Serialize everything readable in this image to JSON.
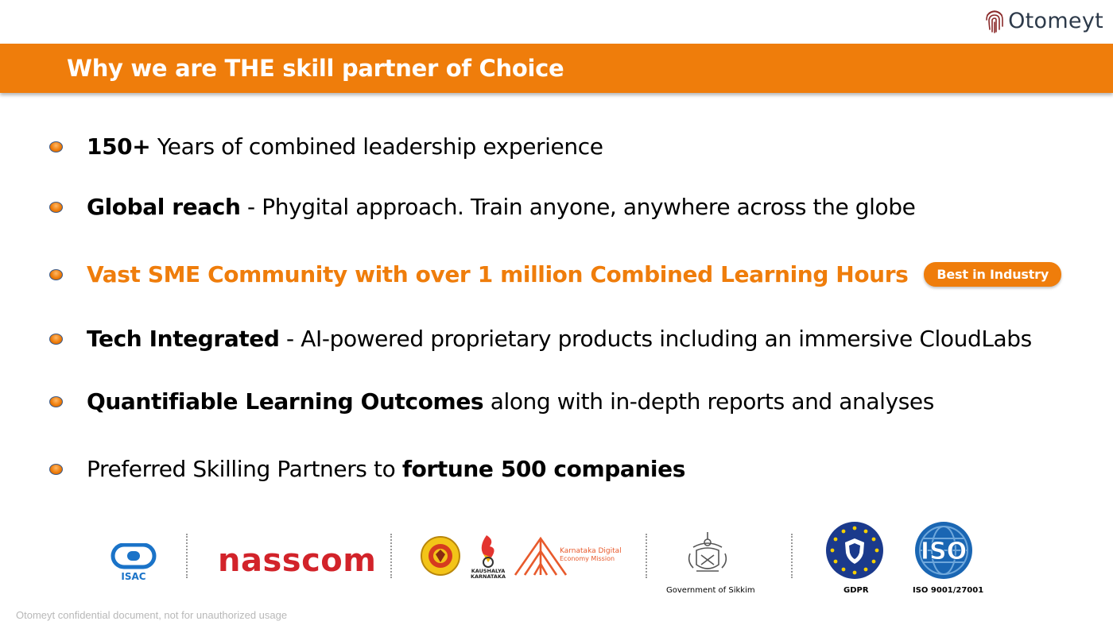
{
  "brand": {
    "name": "Otomeyt",
    "icon": "fingerprint-icon"
  },
  "header": {
    "title": "Why we are THE skill partner of Choice"
  },
  "bullets": [
    {
      "bold": "150+",
      "text": " Years of combined leadership experience"
    },
    {
      "bold": "Global reach",
      "text": " -  Phygital approach. Train anyone, anywhere across the globe"
    },
    {
      "highlight": "Vast SME Community with over 1 million Combined Learning Hours",
      "badge": "Best in Industry"
    },
    {
      "bold": "Tech Integrated",
      "text": " - AI-powered proprietary products including an immersive CloudLabs"
    },
    {
      "bold": "Quantifiable Learning Outcomes",
      "text": " along with in-depth reports and analyses"
    },
    {
      "text": "Preferred Skilling Partners to ",
      "bold": "fortune 500 companies"
    }
  ],
  "logos": {
    "isac": {
      "label": "ISAC",
      "icon": "isac-logo"
    },
    "nasscom": {
      "label": "nasscom"
    },
    "karnataka_gov": {
      "label": "GOVERNMENT OF KARNATAKA",
      "icon": "karnataka-emblem"
    },
    "kaushalya": {
      "label": "KAUSHALYA KARNATAKA",
      "icon": "kaushalya-logo"
    },
    "kdem": {
      "label": "Karnataka Digital Economy Mission",
      "icon": "kdem-logo"
    },
    "sikkim": {
      "caption": "Government of Sikkim",
      "icon": "sikkim-emblem"
    },
    "gdpr": {
      "caption": "GDPR",
      "icon": "gdpr-shield-icon"
    },
    "iso": {
      "label": "ISO",
      "caption": "ISO 9001/27001",
      "icon": "iso-globe-icon"
    }
  },
  "footer": {
    "note": "Otomeyt confidential document, not for unauthorized usage"
  },
  "colors": {
    "accent": "#ef7d0b",
    "text": "#000000",
    "brand_text": "#2d3a4a",
    "nasscom_red": "#d2232a",
    "gdpr_blue": "#1b3a8c",
    "iso_blue": "#1a66b3"
  }
}
